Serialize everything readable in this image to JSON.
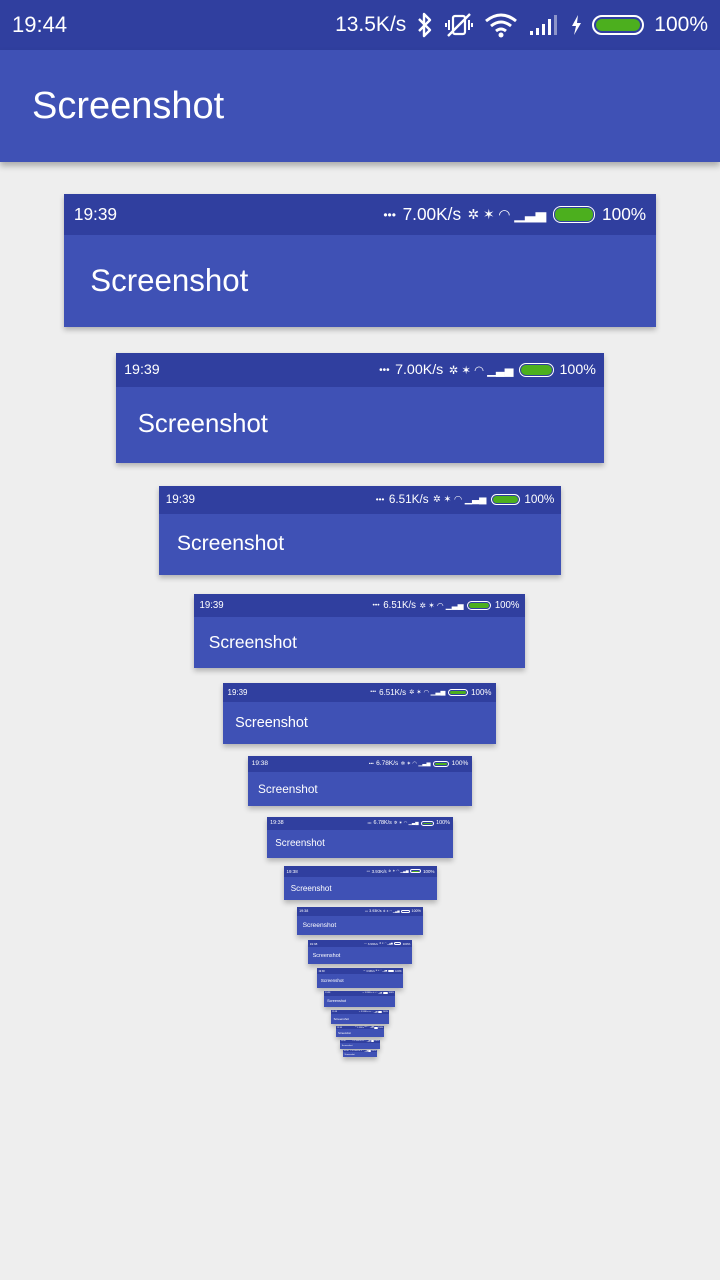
{
  "colors": {
    "status_bar": "#303f9f",
    "app_bar": "#3f51b5",
    "background": "#eeeeee",
    "battery_fill": "#4caf1e"
  },
  "status_bar": {
    "time": "19:44",
    "network_speed": "13.5K/s",
    "battery_percent": "100%",
    "icons": [
      "bluetooth-icon",
      "vibrate-off-icon",
      "wifi-icon",
      "signal-icon",
      "charging-icon",
      "battery-icon"
    ]
  },
  "app_bar": {
    "title": "Screenshot"
  },
  "thumbnails": [
    {
      "time": "19:39",
      "speed": "7.00K/s",
      "battery": "100%",
      "title": "Screenshot"
    },
    {
      "time": "19:39",
      "speed": "7.00K/s",
      "battery": "100%",
      "title": "Screenshot"
    },
    {
      "time": "19:39",
      "speed": "6.51K/s",
      "battery": "100%",
      "title": "Screenshot"
    },
    {
      "time": "19:39",
      "speed": "6.51K/s",
      "battery": "100%",
      "title": "Screenshot"
    },
    {
      "time": "19:39",
      "speed": "6.51K/s",
      "battery": "100%",
      "title": "Screenshot"
    },
    {
      "time": "19:38",
      "speed": "6.78K/s",
      "battery": "100%",
      "title": "Screenshot"
    },
    {
      "time": "19:38",
      "speed": "6.78K/s",
      "battery": "100%",
      "title": "Screenshot"
    },
    {
      "time": "19:38",
      "speed": "3.93K/s",
      "battery": "100%",
      "title": "Screenshot"
    },
    {
      "time": "19:38",
      "speed": "3.93K/s",
      "battery": "100%",
      "title": "Screenshot"
    },
    {
      "time": "19:38",
      "speed": "3.93K/s",
      "battery": "100%",
      "title": "Screenshot"
    },
    {
      "time": "19:38",
      "speed": "3.93K/s",
      "battery": "100%",
      "title": "Screenshot"
    },
    {
      "time": "19:38",
      "speed": "3.93K/s",
      "battery": "100%",
      "title": "Screenshot"
    },
    {
      "time": "19:38",
      "speed": "3.93K/s",
      "battery": "100%",
      "title": "Screenshot"
    },
    {
      "time": "19:38",
      "speed": "3.93K/s",
      "battery": "100%",
      "title": "Screenshot"
    },
    {
      "time": "19:38",
      "speed": "3.93K/s",
      "battery": "100%",
      "title": "Screenshot"
    },
    {
      "time": "19:38",
      "speed": "3.93K/s",
      "battery": "100%",
      "title": "Screenshot"
    }
  ]
}
